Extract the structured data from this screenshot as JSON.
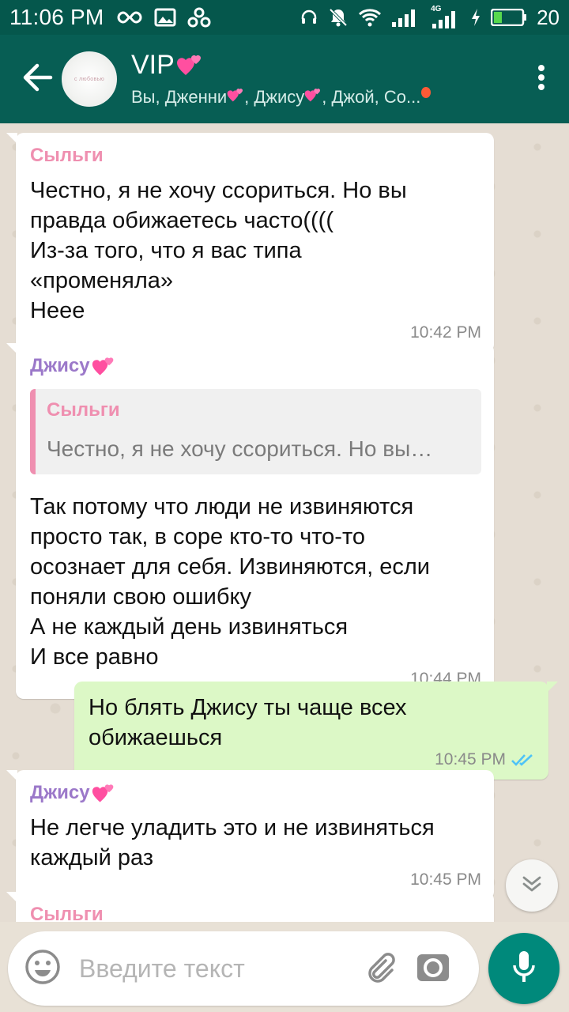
{
  "status_bar": {
    "time": "11:06 PM",
    "battery_level": "20",
    "network": "4G"
  },
  "header": {
    "title": "VIP",
    "subtitle": "Вы, Дженни, Джису, Джой, Со...",
    "subtitle_parts": [
      "Вы, Дженни",
      ", Джису",
      ", Джой, Со..."
    ],
    "avatar_text": "с любовью"
  },
  "messages": [
    {
      "sender": "Сыльги",
      "text": "Честно, я не хочу ссориться. Но вы\nправда обижаетесь часто((((\nИз-за того, что я вас типа\n«променяла»\nНеее",
      "time": "10:42 PM"
    },
    {
      "sender": "Джису",
      "quote_sender": "Сыльги",
      "quote_text": "Честно, я не хочу ссориться. Но вы…",
      "text": "Так потому что люди не извиняются\nпросто так, в соре кто-то что-то\nосознает для себя. Извиняются, если\nпоняли свою ошибку\nА не каждый день извиняться\nИ все равно",
      "time": "10:44 PM"
    },
    {
      "text": "Но блять Джису ты чаще всех\nобижаешься",
      "time": "10:45 PM",
      "read": true
    },
    {
      "sender": "Джису",
      "text": "Не легче уладить это и не извиняться\nкаждый раз",
      "time": "10:45 PM"
    },
    {
      "sender": "Сыльги"
    }
  ],
  "input": {
    "placeholder": "Введите текст"
  },
  "colors": {
    "header": "#075e54",
    "statusbar": "#05574c",
    "outgoing_bubble": "#dcf8c6",
    "sender_pink": "#ef8fb0",
    "sender_purple": "#9b78c9",
    "mic_button": "#00897b",
    "read_ticks": "#4fc3f7"
  },
  "icons": {
    "back": "arrow-left-icon",
    "menu": "more-vert-icon",
    "heart_emoji": "two-hearts-emoji",
    "emoji": "smiley-icon",
    "attach": "paperclip-icon",
    "camera": "camera-icon",
    "mic": "microphone-icon",
    "scroll_down": "double-chevron-down-icon"
  }
}
